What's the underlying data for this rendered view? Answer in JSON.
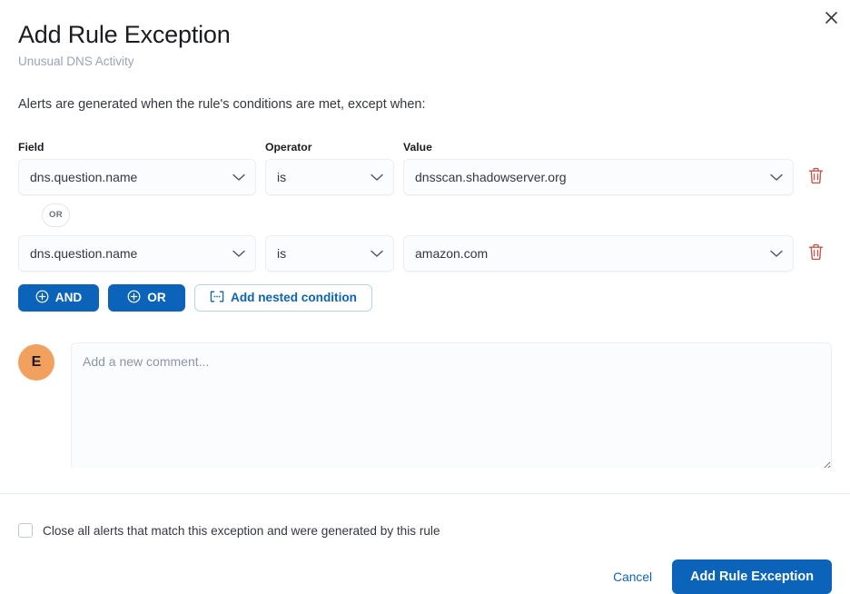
{
  "modal": {
    "title": "Add Rule Exception",
    "subtitle": "Unusual DNS Activity",
    "description": "Alerts are generated when the rule's conditions are met, except when:",
    "close_icon": "close-icon"
  },
  "builder": {
    "column_labels": {
      "field": "Field",
      "operator": "Operator",
      "value": "Value"
    },
    "conditions": [
      {
        "field": "dns.question.name",
        "operator": "is",
        "value": "dnsscan.shadowserver.org",
        "delete_icon": "trash-icon"
      },
      {
        "field": "dns.question.name",
        "operator": "is",
        "value": "amazon.com",
        "delete_icon": "trash-icon"
      }
    ],
    "joiner_badge": "OR",
    "actions": {
      "and_label": "AND",
      "or_label": "OR",
      "nested_label": "Add nested condition",
      "and_icon": "plus-circle-icon",
      "or_icon": "plus-circle-icon",
      "nested_icon": "nested-brackets-icon"
    }
  },
  "comment": {
    "avatar_initial": "E",
    "placeholder": "Add a new comment...",
    "value": ""
  },
  "footer": {
    "checkbox_label": "Close all alerts that match this exception and were generated by this rule",
    "checkbox_checked": false,
    "cancel_label": "Cancel",
    "submit_label": "Add Rule Exception"
  },
  "colors": {
    "primary": "#0B64BA",
    "danger": "#CC544E",
    "avatar": "#F2A05E",
    "subtitle": "#9AA4B4",
    "border": "#ECEEF3"
  }
}
